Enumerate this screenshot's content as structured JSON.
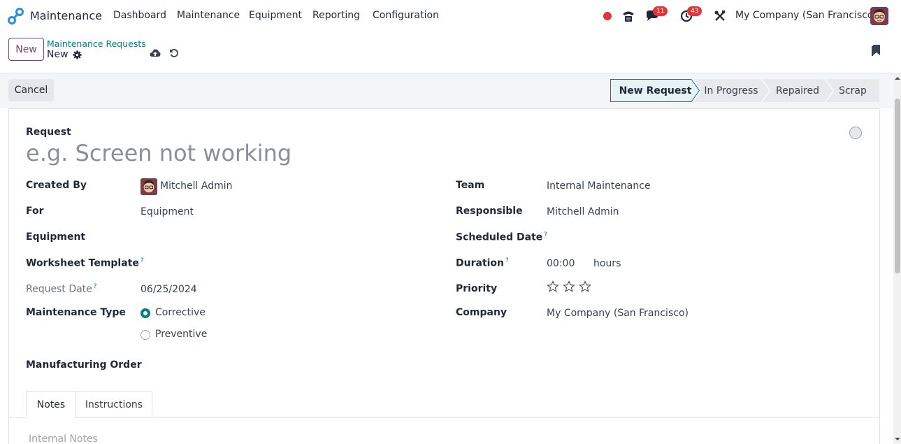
{
  "navbar": {
    "app_name": "Maintenance",
    "menu": [
      "Dashboard",
      "Maintenance",
      "Equipment",
      "Reporting",
      "Configuration"
    ],
    "chat_badge": "11",
    "activity_badge": "43",
    "company": "My Company (San Francisco)"
  },
  "control": {
    "new_label": "New",
    "breadcrumb": "Maintenance Requests",
    "record_name": "New"
  },
  "actions": {
    "cancel_label": "Cancel",
    "stages": [
      "New Request",
      "In Progress",
      "Repaired",
      "Scrap"
    ],
    "active_stage": "New Request"
  },
  "form": {
    "request_label": "Request",
    "title_placeholder": "e.g. Screen not working",
    "left": {
      "created_by_label": "Created By",
      "created_by_value": "Mitchell Admin",
      "for_label": "For",
      "for_value": "Equipment",
      "equipment_label": "Equipment",
      "worksheet_label": "Worksheet Template",
      "request_date_label": "Request Date",
      "request_date_value": "06/25/2024",
      "maintenance_type_label": "Maintenance Type",
      "type_options": [
        "Corrective",
        "Preventive"
      ],
      "type_selected": "Corrective",
      "mo_label": "Manufacturing Order"
    },
    "right": {
      "team_label": "Team",
      "team_value": "Internal Maintenance",
      "responsible_label": "Responsible",
      "responsible_value": "Mitchell Admin",
      "scheduled_label": "Scheduled Date",
      "duration_label": "Duration",
      "duration_value": "00:00",
      "duration_unit": "hours",
      "priority_label": "Priority",
      "priority_stars": 3,
      "priority_value": 0,
      "company_label": "Company",
      "company_value": "My Company (San Francisco)"
    },
    "help_mark": "?",
    "tabs": [
      "Notes",
      "Instructions"
    ],
    "active_tab": "Notes",
    "notes_placeholder": "Internal Notes"
  },
  "colors": {
    "primary": "#714b67",
    "accent": "#017e84",
    "badge": "#e0363c",
    "record_dot": "#e0363c"
  }
}
